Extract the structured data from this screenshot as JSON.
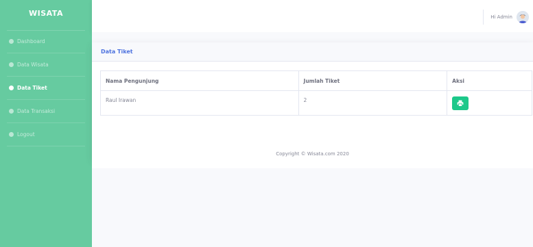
{
  "sidebar": {
    "brand": "WISATA",
    "items": [
      {
        "label": "Dashboard",
        "active": false
      },
      {
        "label": "Data Wisata",
        "active": false
      },
      {
        "label": "Data Tiket",
        "active": true
      },
      {
        "label": "Data Transaksi",
        "active": false
      },
      {
        "label": "Logout",
        "active": false
      }
    ]
  },
  "topbar": {
    "greeting": "Hi Admin"
  },
  "card": {
    "title": "Data Tiket",
    "table": {
      "headers": [
        "Nama Pengunjung",
        "Jumlah Tiket",
        "Aksi"
      ],
      "rows": [
        {
          "nama": "Raul Irawan",
          "jumlah": "2",
          "action_icon": "print-icon"
        }
      ]
    }
  },
  "footer": {
    "copyright": "Copyright © Wisata.com 2020"
  },
  "colors": {
    "sidebar": "#66cba0",
    "accent": "#4e73df",
    "success": "#1cc88a",
    "content_bg": "#f8f9fc"
  }
}
